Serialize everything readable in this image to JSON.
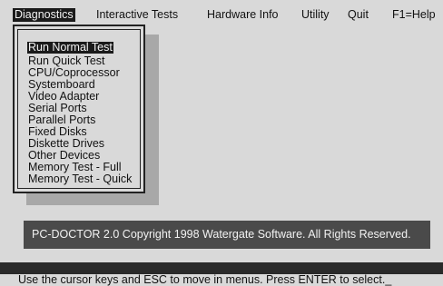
{
  "menubar": {
    "items": [
      {
        "label": "Diagnostics",
        "active": true
      },
      {
        "label": "Interactive Tests",
        "active": false
      },
      {
        "label": "Hardware Info",
        "active": false
      },
      {
        "label": "Utility",
        "active": false
      },
      {
        "label": "Quit",
        "active": false
      },
      {
        "label": "F1=Help",
        "active": false
      }
    ]
  },
  "dropdown": {
    "items": [
      {
        "label": "Run Normal Test",
        "selected": true
      },
      {
        "label": "Run Quick Test"
      },
      {
        "label": "CPU/Coprocessor"
      },
      {
        "label": "Systemboard"
      },
      {
        "label": "Video Adapter"
      },
      {
        "label": "Serial Ports"
      },
      {
        "label": "Parallel Ports"
      },
      {
        "label": "Fixed Disks"
      },
      {
        "label": "Diskette Drives"
      },
      {
        "label": "Other Devices"
      },
      {
        "label": "Memory Test - Full"
      },
      {
        "label": "Memory Test - Quick"
      }
    ]
  },
  "copyright": {
    "text": "PC-DOCTOR 2.0  Copyright  1998 Watergate Software.  All Rights Reserved."
  },
  "status": {
    "text": "Use the cursor keys and ESC to move in menus.  Press ENTER to select._"
  },
  "colors": {
    "background": "#d9d9d9",
    "highlight": "#1a1a1a",
    "banner": "#4a4a4a"
  }
}
